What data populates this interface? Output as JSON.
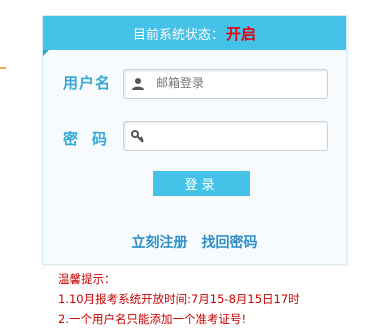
{
  "status": {
    "label": "目前系统状态：",
    "value": "开启"
  },
  "login": {
    "username_label": "用户名",
    "username_placeholder": "邮箱登录",
    "password_label": "密码",
    "password_placeholder": "",
    "submit_label": "登录",
    "register_link": "立刻注册",
    "recover_link": "找回密码"
  },
  "tips": {
    "title": "温馨提示：",
    "items": [
      "1.10月报考系统开放时间:7月15-8月15日17时",
      "2.一个用户名只能添加一个准考证号!"
    ]
  },
  "colors": {
    "accent": "#45c2e8",
    "label": "#35a9d3",
    "status_on": "#e50012",
    "link": "#2d8fc9",
    "tips": "#c80000"
  }
}
